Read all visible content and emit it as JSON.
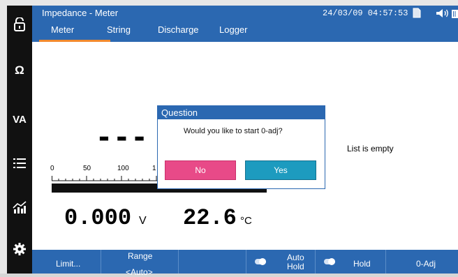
{
  "window": {
    "title": "Impedance - Meter",
    "datetime": "24/03/09 04:57:53"
  },
  "tabs": [
    "Meter",
    "String",
    "Discharge",
    "Logger"
  ],
  "sidebar": {
    "items": [
      {
        "icon": "unlock-icon",
        "label": ""
      },
      {
        "icon": "ohm-icon",
        "label": "Ω"
      },
      {
        "icon": "va-icon",
        "label": "VA"
      },
      {
        "icon": "list-icon",
        "label": ""
      },
      {
        "icon": "chart-icon",
        "label": ""
      },
      {
        "icon": "gear-icon",
        "label": ""
      }
    ]
  },
  "meter": {
    "dashes": "- - -",
    "scale_ticks": [
      "0",
      "50",
      "100",
      "1"
    ],
    "voltage_value": "0.000",
    "voltage_unit": "V",
    "temp_value": "22.6",
    "temp_unit": "°C",
    "list_status": "List is empty"
  },
  "dialog": {
    "title": "Question",
    "message": "Would you like to start 0-adj?",
    "no_label": "No",
    "yes_label": "Yes",
    "no_color": "#e84a88",
    "yes_color": "#1d9bbf"
  },
  "bottom": {
    "limit_label": "Limit...",
    "range_label": "Range",
    "range_value": "<Auto>",
    "autohold_line1": "Auto",
    "autohold_line2": "Hold",
    "hold_label": "Hold",
    "zeroadj_label": "0-Adj"
  },
  "colors": {
    "accent": "#2b68b1",
    "tab_underline": "#f28a2e"
  }
}
